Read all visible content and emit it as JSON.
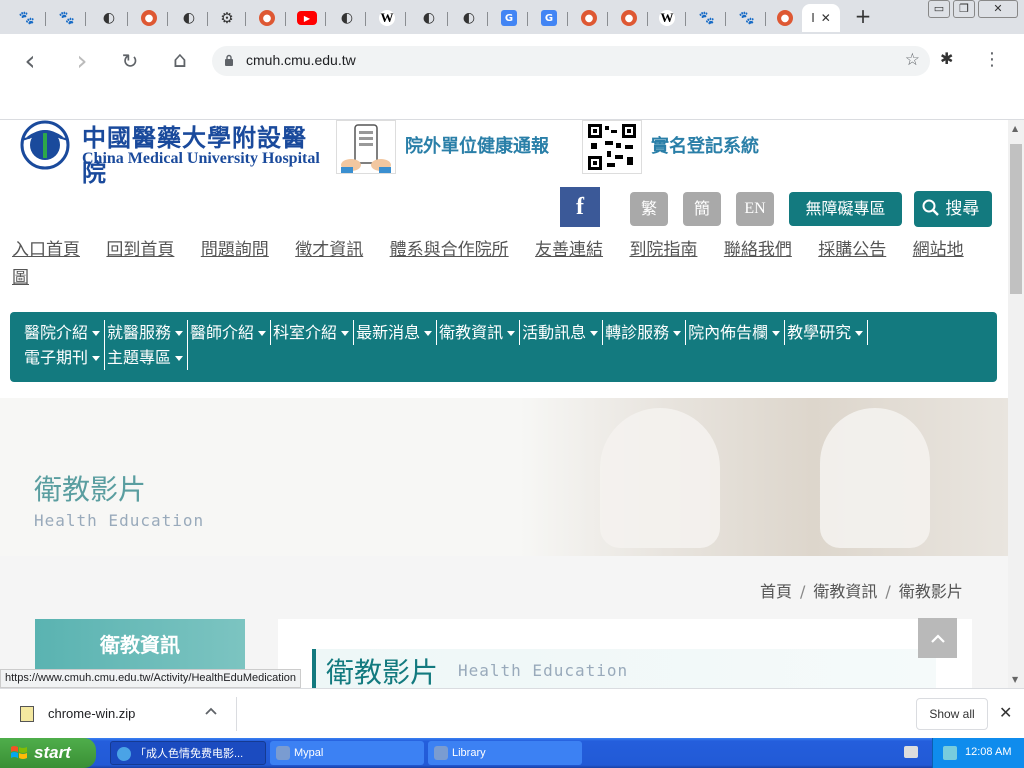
{
  "browser": {
    "tabs": [
      {
        "icon": "paw-icon",
        "color": "#2a55c5",
        "glyph": "🐾"
      },
      {
        "icon": "paw-icon",
        "color": "#2a55c5",
        "glyph": "🐾"
      },
      {
        "icon": "globe-icon",
        "color": "#333333",
        "glyph": "◐"
      },
      {
        "icon": "duckduckgo-icon",
        "color": "#de5833",
        "glyph": "●"
      },
      {
        "icon": "globe-icon",
        "color": "#333333",
        "glyph": "◐"
      },
      {
        "icon": "gear-icon",
        "color": "#333333",
        "glyph": "⚙"
      },
      {
        "icon": "duckduckgo-icon",
        "color": "#de5833",
        "glyph": "●"
      },
      {
        "icon": "youtube-icon",
        "color": "#ff0000",
        "glyph": "▶"
      },
      {
        "icon": "globe-icon",
        "color": "#333333",
        "glyph": "◐"
      },
      {
        "icon": "wikipedia-icon",
        "color": "#000000",
        "glyph": "W"
      },
      {
        "icon": "globe-icon",
        "color": "#333333",
        "glyph": "◐"
      },
      {
        "icon": "globe-icon",
        "color": "#333333",
        "glyph": "◐"
      },
      {
        "icon": "google-translate-icon",
        "color": "#4285f4",
        "glyph": "G"
      },
      {
        "icon": "google-translate-icon",
        "color": "#4285f4",
        "glyph": "G"
      },
      {
        "icon": "duckduckgo-icon",
        "color": "#de5833",
        "glyph": "●"
      },
      {
        "icon": "duckduckgo-icon",
        "color": "#de5833",
        "glyph": "●"
      },
      {
        "icon": "wikipedia-icon",
        "color": "#000000",
        "glyph": "W"
      },
      {
        "icon": "paw-icon",
        "color": "#2a55c5",
        "glyph": "🐾"
      },
      {
        "icon": "paw-icon",
        "color": "#2a55c5",
        "glyph": "🐾"
      },
      {
        "icon": "duckduckgo-icon",
        "color": "#de5833",
        "glyph": "●"
      }
    ],
    "active_tab_label": "I",
    "active_tab_close": "✕",
    "new_tab": "+",
    "window_controls": [
      "▭",
      "❐",
      "✕"
    ],
    "nav": {
      "back": "‹",
      "forward": "›",
      "reload": "↻",
      "home": "⌂"
    },
    "url": "cmuh.cmu.edu.tw",
    "star": "☆",
    "menu": "⋮",
    "extensions": "✱"
  },
  "site": {
    "logo_cn": "中國醫藥大學附設醫院",
    "logo_en": "China Medical University Hospital",
    "header_link_1": "院外單位健康通報",
    "header_link_2": "實名登記系統",
    "facebook": "f",
    "lang_buttons": [
      "繁",
      "簡",
      "EN"
    ],
    "accessibility": "無障礙專區",
    "search": "搜尋",
    "top_links": [
      "入口首頁",
      "回到首頁",
      "問題詢問",
      "徵才資訊",
      "體系與合作院所",
      "友善連結",
      "到院指南",
      "聯絡我們",
      "採購公告",
      "網站地圖"
    ],
    "main_nav": [
      "醫院介紹",
      "就醫服務",
      "醫師介紹",
      "科室介紹",
      "最新消息",
      "衛教資訊",
      "活動訊息",
      "轉診服務",
      "院內佈告欄",
      "教學研究",
      "電子期刊",
      "主題專區"
    ],
    "banner_title": "衛教影片",
    "banner_sub": "Health Education",
    "breadcrumb": [
      "首頁",
      "衛教資訊",
      "衛教影片"
    ],
    "breadcrumb_sep": "/",
    "side_title": "衛教資訊",
    "content_title": "衛教影片",
    "content_title_en": "Health Education",
    "to_top": "^",
    "status_url": "https://www.cmuh.cmu.edu.tw/Activity/HealthEduMedication"
  },
  "downloads": {
    "file": "chrome-win.zip",
    "chevron": "^",
    "show_all": "Show all",
    "close": "✕"
  },
  "taskbar": {
    "start": "start",
    "items": [
      {
        "label": "「成人色情免费电影...",
        "color": "#4aa3e6"
      },
      {
        "label": "Mypal",
        "color": "#7a9cd1"
      },
      {
        "label": "Library",
        "color": "#7a9cd1"
      }
    ],
    "time": "12:08 AM"
  },
  "colors": {
    "teal": "#137a7f",
    "brand_blue": "#1a4a9c",
    "facebook": "#3b5998"
  }
}
